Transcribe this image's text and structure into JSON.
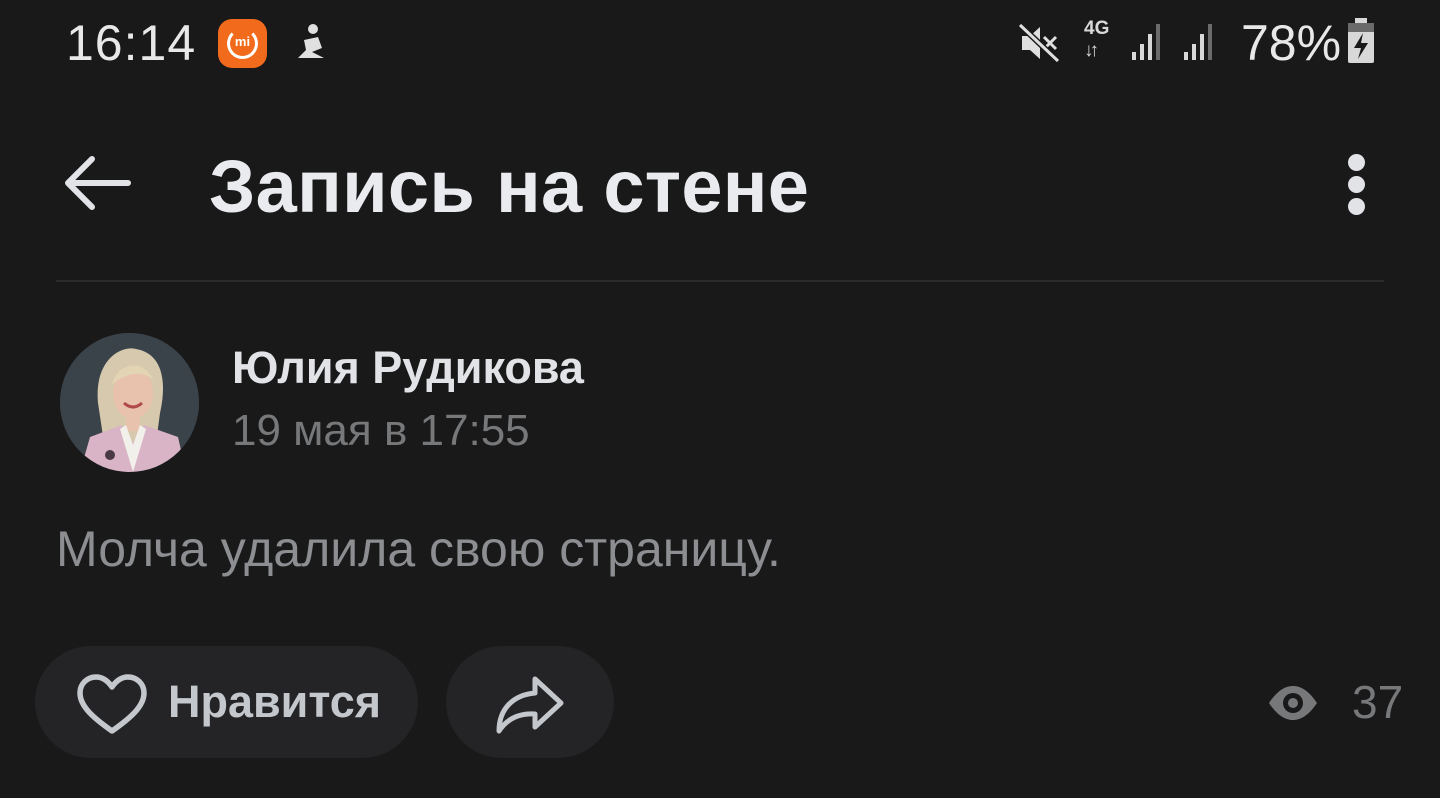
{
  "status_bar": {
    "time": "16:14",
    "mi_label": "mi",
    "network": "4G",
    "network_arrows": "↓↑",
    "battery_percent": "78%",
    "icons": [
      "mi-home-icon",
      "figure-icon",
      "mute-icon",
      "signal-icon",
      "battery-charging-icon"
    ]
  },
  "header": {
    "title": "Запись на стене",
    "back_icon": "arrow-left-icon",
    "menu_icon": "more-vertical-icon"
  },
  "post": {
    "author": "Юлия Рудикова",
    "date": "19 мая в 17:55",
    "text": "Молча удалила свою страницу."
  },
  "actions": {
    "like_label": "Нравится",
    "views_count": "37"
  },
  "colors": {
    "background": "#19191a",
    "primary_text": "#e1e3e6",
    "secondary_text": "#76787a",
    "button_bg": "#242426",
    "accent_orange": "#f26a1b"
  }
}
